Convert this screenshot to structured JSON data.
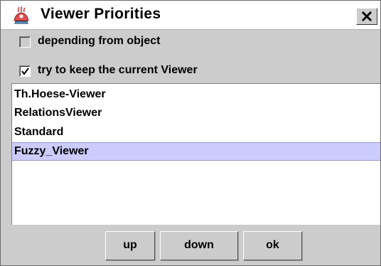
{
  "window": {
    "title": "Viewer Priorities",
    "app_icon": "java-duke-icon",
    "close_icon": "close-icon"
  },
  "options": {
    "depending_from_object": {
      "label": "depending from object",
      "checked": false
    },
    "keep_current_viewer": {
      "label": "try to keep the current Viewer",
      "checked": true
    }
  },
  "viewers": {
    "items": [
      {
        "label": "Th.Hoese-Viewer",
        "selected": false
      },
      {
        "label": "RelationsViewer",
        "selected": false
      },
      {
        "label": "Standard",
        "selected": false
      },
      {
        "label": "Fuzzy_Viewer",
        "selected": true
      }
    ]
  },
  "buttons": {
    "up": "up",
    "down": "down",
    "ok": "ok"
  },
  "colors": {
    "window_bg": "#cccccc",
    "selection_bg": "#ccccff",
    "list_bg": "#ffffff"
  }
}
